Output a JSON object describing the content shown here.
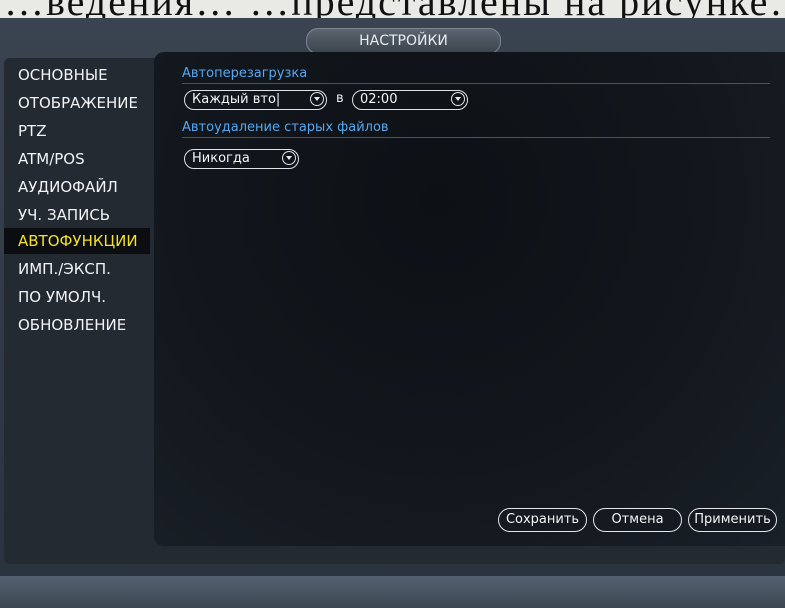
{
  "document_text": "…ведения… …представлены на рисунке…",
  "header": {
    "title": "НАСТРОЙКИ"
  },
  "sidebar": {
    "items": [
      {
        "label": "ОСНОВНЫЕ"
      },
      {
        "label": "ОТОБРАЖЕНИЕ"
      },
      {
        "label": "PTZ"
      },
      {
        "label": "ATM/POS"
      },
      {
        "label": "АУДИОФАЙЛ"
      },
      {
        "label": "УЧ. ЗАПИСЬ"
      },
      {
        "label": "АВТОФУНКЦИИ",
        "active": true
      },
      {
        "label": "ИМП./ЭКСП."
      },
      {
        "label": "ПО УМОЛЧ."
      },
      {
        "label": "ОБНОВЛЕНИЕ"
      }
    ]
  },
  "auto_reboot": {
    "title": "Автоперезагрузка",
    "day_value": "Каждый вто|",
    "at_label": "в",
    "time_value": "02:00"
  },
  "auto_delete": {
    "title": "Автоудаление старых файлов",
    "value": "Никогда"
  },
  "buttons": {
    "save": "Сохранить",
    "cancel": "Отмена",
    "apply": "Применить"
  },
  "colors": {
    "accent_active": "#f3e12a",
    "section_title": "#56a7f0"
  }
}
